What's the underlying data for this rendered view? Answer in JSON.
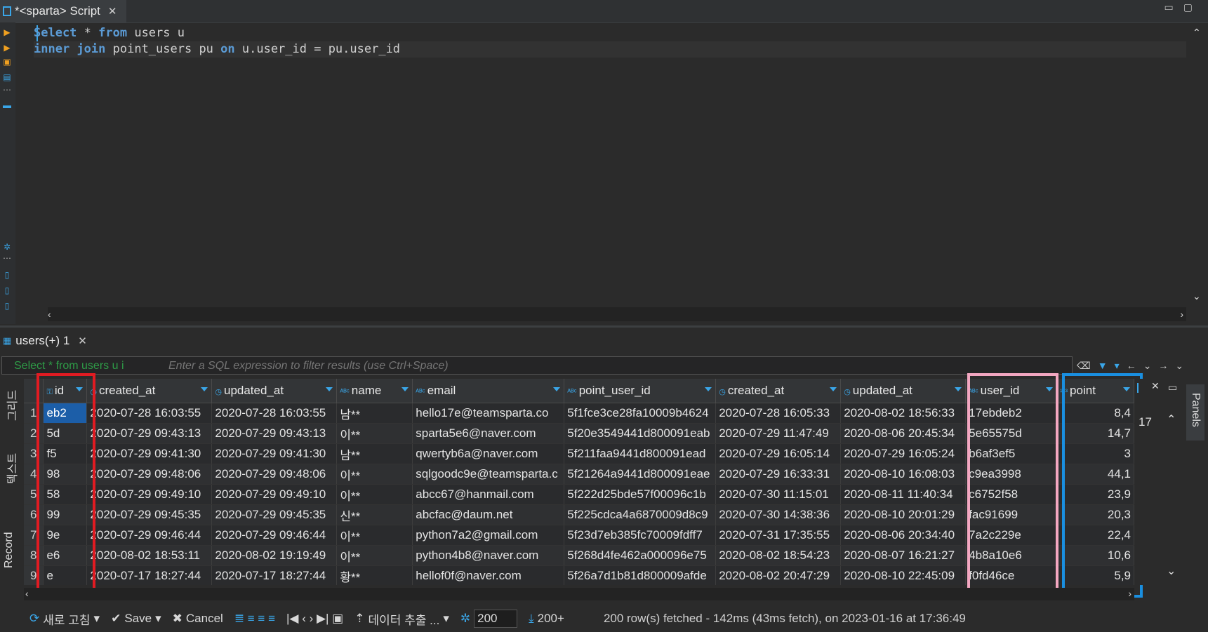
{
  "editor_tab": {
    "title": "*<sparta> Script"
  },
  "editor": {
    "lines": [
      [
        {
          "t": "Select",
          "k": true
        },
        {
          "t": " * "
        },
        {
          "t": "from",
          "k": true
        },
        {
          "t": " users u"
        }
      ],
      [
        {
          "t": "inner",
          "k": true
        },
        {
          "t": " "
        },
        {
          "t": "join",
          "k": true
        },
        {
          "t": " point_users pu "
        },
        {
          "t": "on",
          "k": true
        },
        {
          "t": " u.user_id = pu.user_id"
        }
      ]
    ]
  },
  "results_tab": {
    "title": "users(+) 1"
  },
  "filter": {
    "query_label": "Select * from users u i",
    "placeholder": "Enter a SQL expression to filter results (use Ctrl+Space)"
  },
  "left_tabs": [
    "그리드",
    "텍스트",
    "Record"
  ],
  "grid": {
    "columns": [
      {
        "label": "id",
        "icon": "key-icon"
      },
      {
        "label": "created_at",
        "icon": "clock-icon"
      },
      {
        "label": "updated_at",
        "icon": "clock-icon"
      },
      {
        "label": "name",
        "icon": "abc-icon"
      },
      {
        "label": "email",
        "icon": "abc-icon"
      },
      {
        "label": "point_user_id",
        "icon": "abc-icon"
      },
      {
        "label": "created_at",
        "icon": "clock-icon"
      },
      {
        "label": "updated_at",
        "icon": "clock-icon"
      },
      {
        "label": "user_id",
        "icon": "abc-icon"
      },
      {
        "label": "point",
        "icon": "num-icon"
      }
    ],
    "rows": [
      [
        "1",
        "eb2",
        "2020-07-28 16:03:55",
        "2020-07-28 16:03:55",
        "남**",
        "hello17e@teamsparta.co",
        "5f1fce3ce28fa10009b4624",
        "2020-07-28 16:05:33",
        "2020-08-02 18:56:33",
        "17ebdeb2",
        "8,4"
      ],
      [
        "2",
        "5d",
        "2020-07-29 09:43:13",
        "2020-07-29 09:43:13",
        "이**",
        "sparta5e6@naver.com",
        "5f20e3549441d800091eab",
        "2020-07-29 11:47:49",
        "2020-08-06 20:45:34",
        "5e65575d",
        "14,7"
      ],
      [
        "3",
        "f5",
        "2020-07-29 09:41:30",
        "2020-07-29 09:41:30",
        "남**",
        "qwertyb6a@naver.com",
        "5f211faa9441d800091ead",
        "2020-07-29 16:05:14",
        "2020-07-29 16:05:24",
        "b6af3ef5",
        "3"
      ],
      [
        "4",
        "98",
        "2020-07-29 09:48:06",
        "2020-07-29 09:48:06",
        "이**",
        "sqlgoodc9e@teamsparta.c",
        "5f21264a9441d800091eae",
        "2020-07-29 16:33:31",
        "2020-08-10 16:08:03",
        "c9ea3998",
        "44,1"
      ],
      [
        "5",
        "58",
        "2020-07-29 09:49:10",
        "2020-07-29 09:49:10",
        "이**",
        "abcc67@hanmail.com",
        "5f222d25bde57f00096c1b",
        "2020-07-30 11:15:01",
        "2020-08-11 11:40:34",
        "c6752f58",
        "23,9"
      ],
      [
        "6",
        "99",
        "2020-07-29 09:45:35",
        "2020-07-29 09:45:35",
        "신**",
        "abcfac@daum.net",
        "5f225cdca4a6870009d8c9",
        "2020-07-30 14:38:36",
        "2020-08-10 20:01:29",
        "fac91699",
        "20,3"
      ],
      [
        "7",
        "9e",
        "2020-07-29 09:46:44",
        "2020-07-29 09:46:44",
        "이**",
        "python7a2@gmail.com",
        "5f23d7eb385fc70009fdff7",
        "2020-07-31 17:35:55",
        "2020-08-06 20:34:40",
        "7a2c229e",
        "22,4"
      ],
      [
        "8",
        "e6",
        "2020-08-02 18:53:11",
        "2020-08-02 19:19:49",
        "이**",
        "python4b8@naver.com",
        "5f268d4fe462a000096e75",
        "2020-08-02 18:54:23",
        "2020-08-07 16:21:27",
        "4b8a10e6",
        "10,6"
      ],
      [
        "9",
        "e",
        "2020-07-17 18:27:44",
        "2020-07-17 18:27:44",
        "황**",
        "hellof0f@naver.com",
        "5f26a7d1b81d800009afde",
        "2020-08-02 20:47:29",
        "2020-08-10 22:45:09",
        "f0fd46ce",
        "5,9"
      ]
    ]
  },
  "side_panel": {
    "value": "17",
    "label": "Panels"
  },
  "toolbar": {
    "refresh": "새로 고침",
    "save": "Save",
    "cancel": "Cancel",
    "export": "데이터 추출 ...",
    "rows": "200",
    "fetch_more": "200+",
    "status": "200 row(s) fetched - 142ms (43ms fetch), on 2023-01-16 at 17:36:49"
  },
  "colors": {
    "keyword": "#5b9bd5",
    "selection": "#1c5ea8",
    "annotation_red": "#e11b22",
    "annotation_pink": "#f3a7c1",
    "annotation_blue": "#1a8fe0"
  }
}
